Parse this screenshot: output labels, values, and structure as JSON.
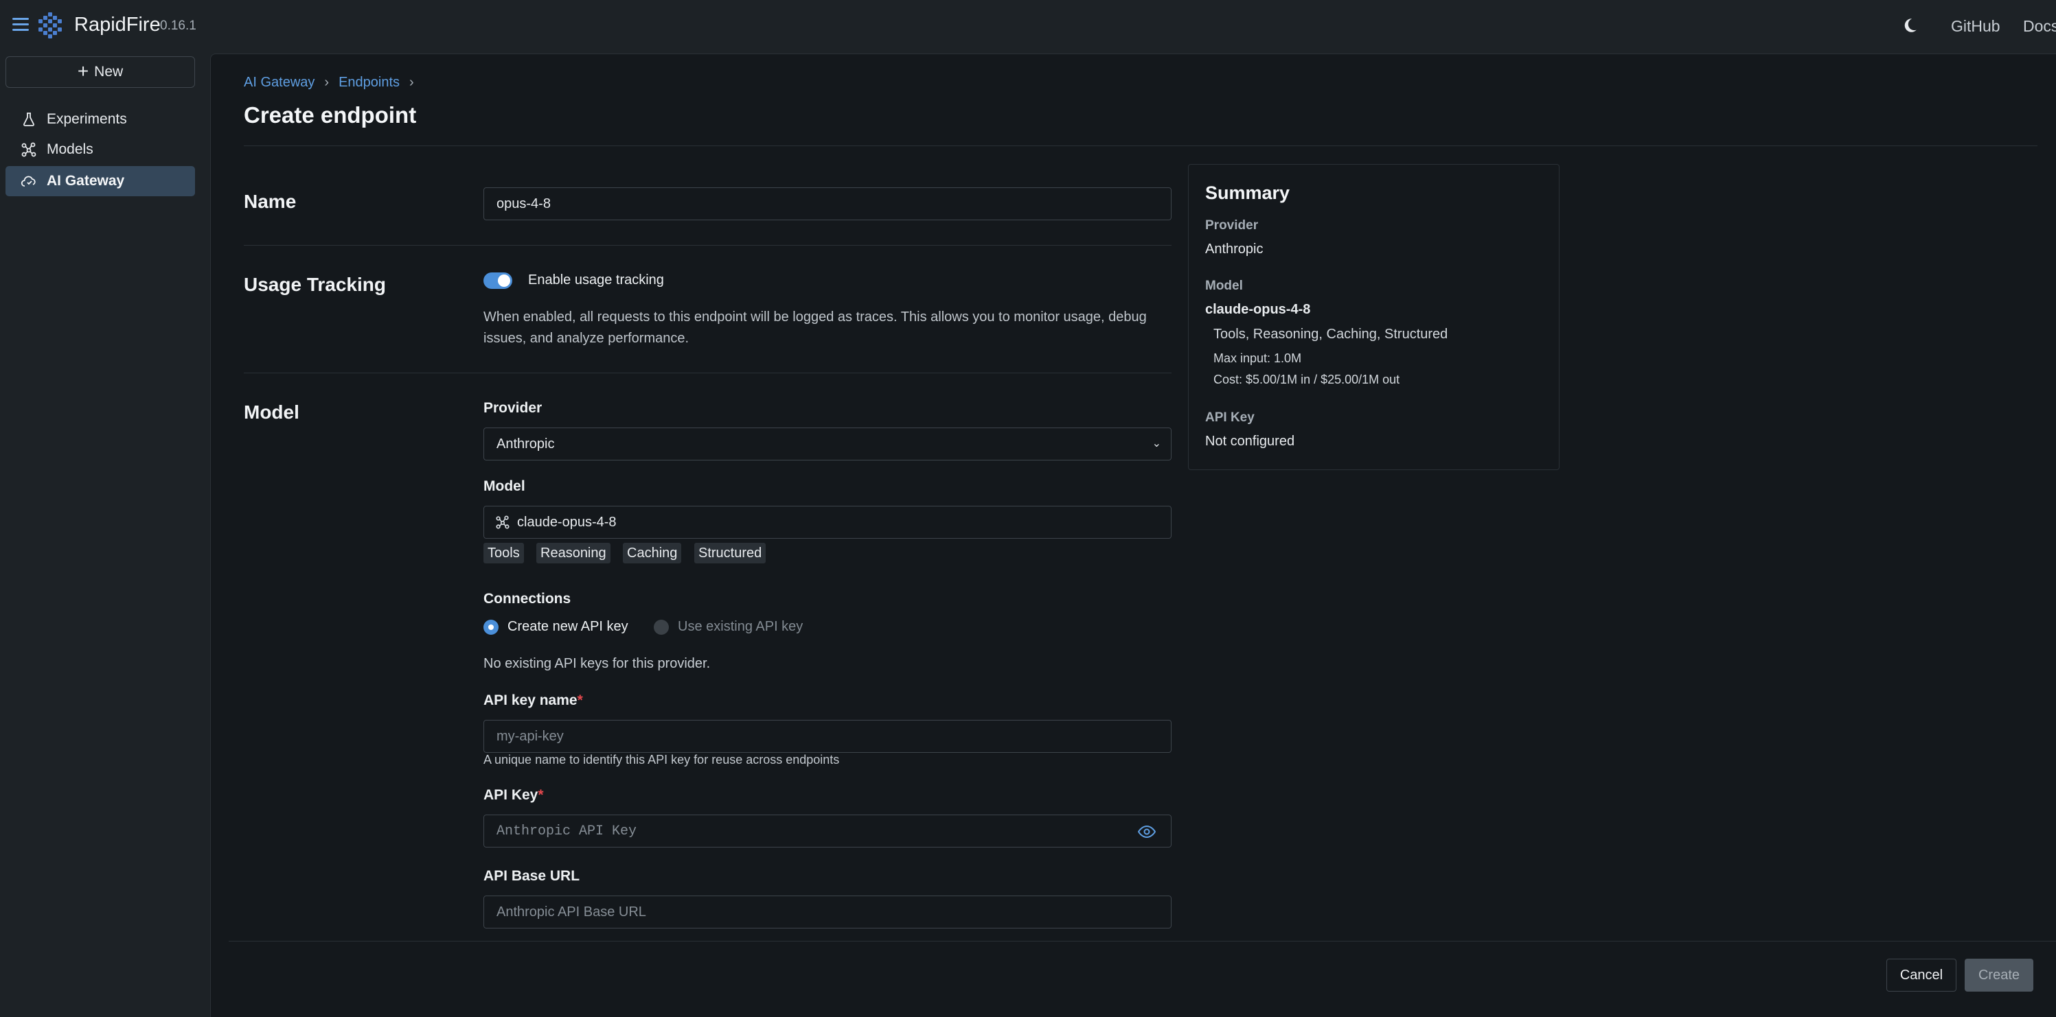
{
  "app": {
    "name": "RapidFire",
    "version": "0.16.1"
  },
  "topnav": {
    "links": [
      "GitHub",
      "Docs"
    ]
  },
  "sidebar": {
    "new_label": "New",
    "items": [
      {
        "label": "Experiments",
        "icon": "experiments-icon"
      },
      {
        "label": "Models",
        "icon": "models-icon"
      },
      {
        "label": "AI Gateway",
        "icon": "gateway-icon",
        "active": true
      }
    ]
  },
  "breadcrumb": [
    "AI Gateway",
    "Endpoints"
  ],
  "page": {
    "title": "Create endpoint"
  },
  "form": {
    "name": {
      "section": "Name",
      "value": "opus-4-8"
    },
    "usage": {
      "section": "Usage Tracking",
      "toggle_label": "Enable usage tracking",
      "enabled": true,
      "description": "When enabled, all requests to this endpoint will be logged as traces. This allows you to monitor usage, debug issues, and analyze performance."
    },
    "model": {
      "section": "Model",
      "provider_label": "Provider",
      "provider_value": "Anthropic",
      "model_label": "Model",
      "model_value": "claude-opus-4-8",
      "tags": [
        "Tools",
        "Reasoning",
        "Caching",
        "Structured"
      ],
      "connections_label": "Connections",
      "radio_new": "Create new API key",
      "radio_existing": "Use existing API key",
      "no_keys_text": "No existing API keys for this provider.",
      "api_key_name_label": "API key name",
      "api_key_name_placeholder": "my-api-key",
      "api_key_name_hint": "A unique name to identify this API key for reuse across endpoints",
      "api_key_label": "API Key",
      "api_key_placeholder": "Anthropic API Key",
      "base_url_label": "API Base URL",
      "base_url_placeholder": "Anthropic API Base URL"
    }
  },
  "summary": {
    "title": "Summary",
    "provider_label": "Provider",
    "provider_value": "Anthropic",
    "model_label": "Model",
    "model_value": "claude-opus-4-8",
    "capabilities": "Tools, Reasoning, Caching, Structured",
    "max_input": "Max input: 1.0M",
    "cost": "Cost: $5.00/1M in / $25.00/1M out",
    "api_key_label": "API Key",
    "api_key_value": "Not configured"
  },
  "footer": {
    "cancel": "Cancel",
    "create": "Create"
  },
  "colors": {
    "accent": "#4b8fd9",
    "link": "#5f9fe3",
    "required": "#e5484d"
  }
}
